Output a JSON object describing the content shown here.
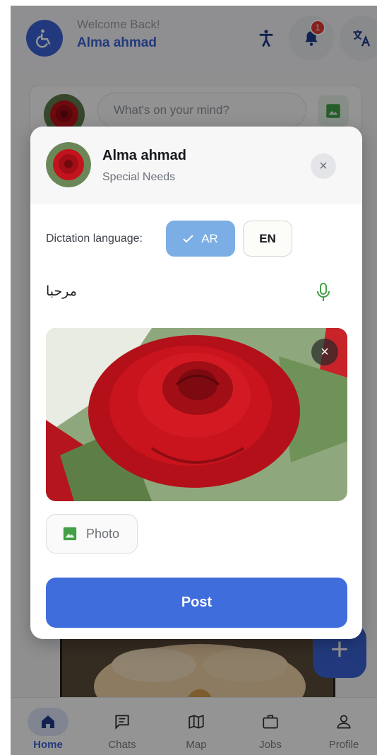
{
  "header": {
    "welcome": "Welcome Back!",
    "username": "Alma ahmad",
    "notification_count": "1"
  },
  "composer": {
    "placeholder": "What's on your mind?"
  },
  "bottom_nav": {
    "items": [
      {
        "label": "Home",
        "icon": "home-icon",
        "active": true
      },
      {
        "label": "Chats",
        "icon": "chat-icon",
        "active": false
      },
      {
        "label": "Map",
        "icon": "map-icon",
        "active": false
      },
      {
        "label": "Jobs",
        "icon": "briefcase-icon",
        "active": false
      },
      {
        "label": "Profile",
        "icon": "person-icon",
        "active": false
      }
    ]
  },
  "fab": {
    "label": "+"
  },
  "dialog": {
    "user_name": "Alma ahmad",
    "user_role": "Special Needs",
    "close": "×",
    "dictation_label": "Dictation language:",
    "languages": [
      {
        "label": "AR",
        "selected": true
      },
      {
        "label": "EN",
        "selected": false
      }
    ],
    "dictated_text": "مرحبا",
    "remove_photo": "×",
    "photo_button": "Photo",
    "post_button": "Post"
  },
  "colors": {
    "primary": "#3b64d8",
    "selected_language": "#7aaee4",
    "mic_green": "#43a047",
    "badge_red": "#e53935"
  }
}
